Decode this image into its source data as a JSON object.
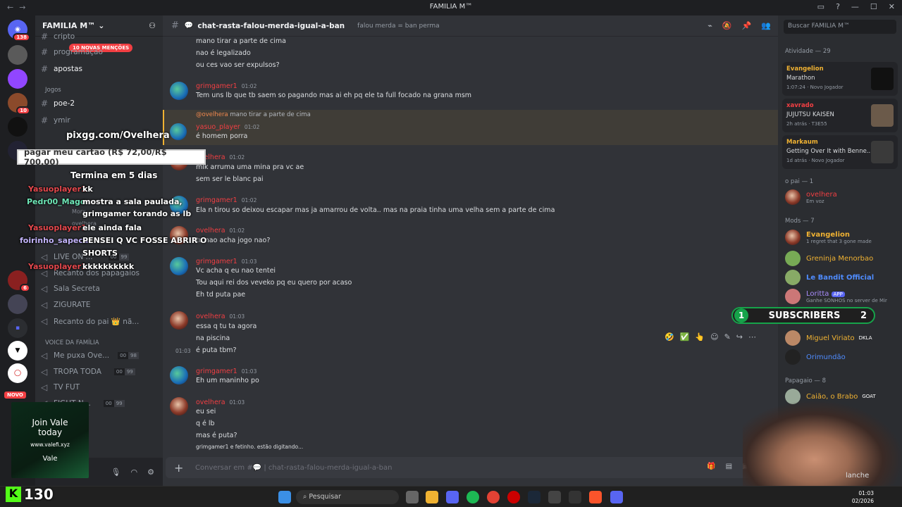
{
  "window": {
    "title": "FAMILIA M™",
    "back": "←",
    "forward": "→"
  },
  "server": {
    "name": "FAMILIA M™",
    "mentions_badge": "10 NOVAS MENÇÕES"
  },
  "server_badges": [
    "138",
    "10",
    "6",
    "NOVO"
  ],
  "channels": [
    {
      "name": "cripto",
      "type": "text"
    },
    {
      "name": "programação",
      "type": "text"
    },
    {
      "name": "apostas",
      "type": "text"
    },
    {
      "category": "Jogos"
    },
    {
      "name": "poe-2",
      "type": "text"
    },
    {
      "name": "ymir",
      "type": "text"
    }
  ],
  "voice_channels": [
    {
      "name": "LIVE ON ...",
      "c1": "00",
      "c2": "99"
    },
    {
      "name": "Recanto dos papagaios"
    },
    {
      "name": "Sala Secreta"
    },
    {
      "name": "ZIGURATE"
    },
    {
      "name": "Recanto do pai 👑 nã..."
    }
  ],
  "voice_category": "VOICE DA FAMÍLIA",
  "voice_channels2": [
    {
      "name": "Me puxa Ove...",
      "c1": "00",
      "c2": "98"
    },
    {
      "name": "TROPA TODA",
      "c1": "00",
      "c2": "99"
    },
    {
      "name": "TV FUT"
    },
    {
      "name": "FIGHT N...",
      "c1": "00",
      "c2": "99"
    }
  ],
  "sidebar_users": [
    "Morx",
    "ovelhera"
  ],
  "channel": {
    "name": "chat-rasta-falou-merda-igual-a-ban",
    "topic": "falou merda = ban perma"
  },
  "messages": [
    {
      "lines": [
        "mano tirar a parte de cima",
        "nao é legalizado",
        "ou ces vao ser expulsos?"
      ]
    },
    {
      "author": "grimgamer1",
      "time": "01:02",
      "lines": [
        "Tem uns lb que tb saem so pagando mas ai eh pq ele ta full focado na grana msm"
      ]
    },
    {
      "reply_to": "@ovelhera",
      "reply_text": "mano tirar a parte de cima",
      "author": "yasuo_player",
      "time": "01:02",
      "lines": [
        "é homem porra"
      ]
    },
    {
      "author": "ovelhera",
      "time": "01:02",
      "lines": [
        "mlk arruma uma mina pra vc ae",
        "sem ser le blanc pai"
      ]
    },
    {
      "author": "grimgamer1",
      "time": "01:02",
      "lines": [
        "Ela n tirou so deixou escapar mas ja amarrou de volta.. mas na praia tinha uma velha sem a parte de cima"
      ]
    },
    {
      "author": "ovelhera",
      "time": "01:02",
      "lines": [
        "tu nao acha jogo nao?"
      ]
    },
    {
      "author": "grimgamer1",
      "time": "01:03",
      "lines": [
        "Vc acha q eu nao tentei",
        "Tou aqui rei dos veveko pq eu quero por acaso",
        "Eh td puta pae"
      ]
    },
    {
      "author": "ovelhera",
      "time": "01:03",
      "lines": [
        "essa q tu ta agora",
        "na piscina",
        "é puta tbm?"
      ],
      "inline_time": "01:03"
    },
    {
      "author": "grimgamer1",
      "time": "01:03",
      "lines": [
        "Eh um maninho po"
      ]
    },
    {
      "author": "ovelhera",
      "time": "01:03",
      "lines": [
        "eu sei",
        "q é lb",
        "mas é puta?"
      ]
    }
  ],
  "typing": "grimgamer1 e fetinho. estão digitando...",
  "composer": {
    "placeholder": "Conversar em #💬 | chat-rasta-falou-merda-igual-a-ban"
  },
  "members": {
    "search_placeholder": "Buscar FAMILIA M™",
    "activity_header": "Atividade — 29",
    "activity": [
      {
        "name": "Evangelion",
        "game": "Marathon",
        "meta": "1:07:24 · Novo Jogador",
        "color": "#f0b232"
      },
      {
        "name": "xavrado",
        "game": "JUJUTSU KAISEN",
        "meta": "2h atrás · T3E55",
        "color": "#f23f43"
      },
      {
        "name": "Markaum",
        "game": "Getting Over It with Benne...",
        "meta": "1d atrás · Novo Jogador",
        "color": "#f0b232"
      }
    ],
    "groups": [
      {
        "label": "o pai — 1",
        "members": [
          {
            "name": "ovelhera",
            "status": "Em voz",
            "color": "#f23f43"
          }
        ]
      },
      {
        "label": "Mods — 7",
        "members": [
          {
            "name": "Evangelion",
            "status": "1 regret that 3 gone made",
            "color": "#f0b232"
          },
          {
            "name": "Greninja Menorbao",
            "color": "#f0b232"
          },
          {
            "name": "Le Bandit Official",
            "color": "#4f8cff"
          },
          {
            "name": "Loritta",
            "status": "Ganhe SONHOS no server de Mir",
            "color": "#a78bfa",
            "tag": "APP"
          },
          {
            "name": "Miguel Viriato",
            "color": "#f0b232",
            "tag": "DKLA"
          },
          {
            "name": "Orimundão",
            "color": "#4f8cff"
          }
        ]
      },
      {
        "label": "Papagaio — 8",
        "members": [
          {
            "name": "Caião, o Brabo",
            "color": "#f0b232",
            "tag": "GOAT"
          }
        ]
      }
    ]
  },
  "overlay": {
    "pixgg": "pixgg.com/Ovelhera",
    "donation_card": "pagar meu cartao (R$ 72,00/R$ 700,00)",
    "countdown": "Termina em 5 dias",
    "chat": [
      {
        "nick": "Yasuoplayer1",
        "text": "kk",
        "color": "#e5484d"
      },
      {
        "nick": "Pedr00_Mago",
        "text": "mostra a sala paulada,",
        "color": "#6ee7b7"
      },
      {
        "nick": "",
        "text": "grimgamer torando as lb",
        "color": "#ffffff"
      },
      {
        "nick": "Yasuoplayer1",
        "text": "ele ainda fala",
        "color": "#e5484d"
      },
      {
        "nick": "foirinho_sapeca",
        "text": "PENSEI Q VC FOSSE ABRIR O",
        "color": "#c4b5fd"
      },
      {
        "nick": "",
        "text": "SHORTS",
        "color": "#ffffff"
      },
      {
        "nick": "Yasuoplayer1",
        "text": "kkkkkkkkkk",
        "color": "#e5484d"
      }
    ],
    "subs": {
      "left": "1",
      "label": "SUBSCRIBERS",
      "right": "2"
    },
    "vale": {
      "title": "Join Vale",
      "subtitle": "today",
      "url": "www.valefi.xyz",
      "brand": "Vale"
    },
    "kick_count": "130",
    "webcam_caption": "lanche"
  },
  "taskbar": {
    "search": "Pesquisar",
    "time": "01:03",
    "date": "02/2026"
  }
}
